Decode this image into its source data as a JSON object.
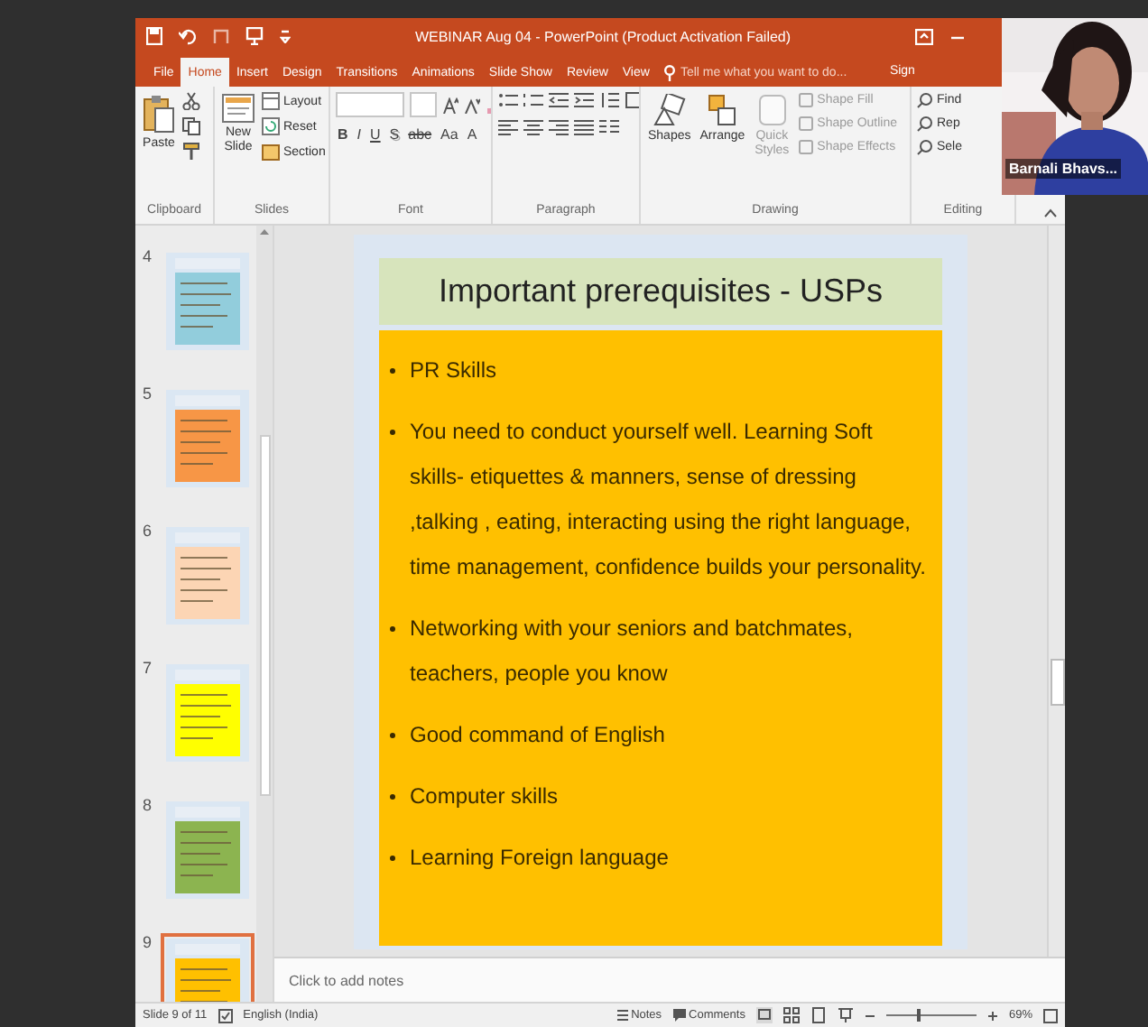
{
  "window": {
    "title": "WEBINAR Aug 04 - PowerPoint (Product Activation Failed)"
  },
  "ribbon_tabs": [
    {
      "label": "File",
      "selected": false
    },
    {
      "label": "Home",
      "selected": true
    },
    {
      "label": "Insert",
      "selected": false
    },
    {
      "label": "Design",
      "selected": false
    },
    {
      "label": "Transitions",
      "selected": false
    },
    {
      "label": "Animations",
      "selected": false
    },
    {
      "label": "Slide Show",
      "selected": false
    },
    {
      "label": "Review",
      "selected": false
    },
    {
      "label": "View",
      "selected": false
    }
  ],
  "tell_me": {
    "placeholder": "Tell me what you want to do..."
  },
  "sign_in": "Sign",
  "ribbon_groups": [
    {
      "kind": "clipboard",
      "label": "Clipboard",
      "buttons": [
        "Paste"
      ]
    },
    {
      "kind": "slides",
      "label": "Slides",
      "buttons": [
        "New Slide",
        "Layout",
        "Reset",
        "Section"
      ]
    },
    {
      "kind": "font",
      "label": "Font",
      "buttons": [
        "B",
        "I",
        "U",
        "S",
        "abc",
        "Aa",
        "A"
      ]
    },
    {
      "kind": "paragraph",
      "label": "Paragraph"
    },
    {
      "kind": "drawing",
      "label": "Drawing",
      "buttons": [
        "Shapes",
        "Arrange",
        "Quick Styles",
        "Shape Fill",
        "Shape Outline",
        "Shape Effects"
      ]
    },
    {
      "kind": "editing",
      "label": "Editing",
      "buttons": [
        "Find",
        "Rep",
        "Sele"
      ]
    }
  ],
  "thumbnails": [
    {
      "number": "4",
      "color": "#92cddc",
      "selected": false
    },
    {
      "number": "5",
      "color": "#f79646",
      "selected": false
    },
    {
      "number": "6",
      "color": "#fcd5b4",
      "selected": false
    },
    {
      "number": "7",
      "color": "#ffff00",
      "selected": false
    },
    {
      "number": "8",
      "color": "#8cb450",
      "selected": false
    },
    {
      "number": "9",
      "color": "#ffc000",
      "selected": true
    }
  ],
  "slide": {
    "title": "Important prerequisites - USPs",
    "bullets": [
      "PR Skills",
      "You need to conduct yourself well. Learning Soft skills- etiquettes & manners, sense of dressing ,talking , eating, interacting using the right language, time management, confidence builds your personality.",
      "Networking with your seniors and batchmates, teachers, people you know",
      "Good command of English",
      "Computer skills",
      "Learning Foreign language"
    ]
  },
  "notes": {
    "placeholder": "Click to add notes"
  },
  "status_bar": {
    "slide_position": "Slide 9 of 11",
    "language": "English (India)",
    "notes": "Notes",
    "comments": "Comments",
    "zoom": {
      "level": 0.36
    },
    "zoom_percent": "69%"
  },
  "video_tile": {
    "name": "Barnali Bhavs..."
  }
}
